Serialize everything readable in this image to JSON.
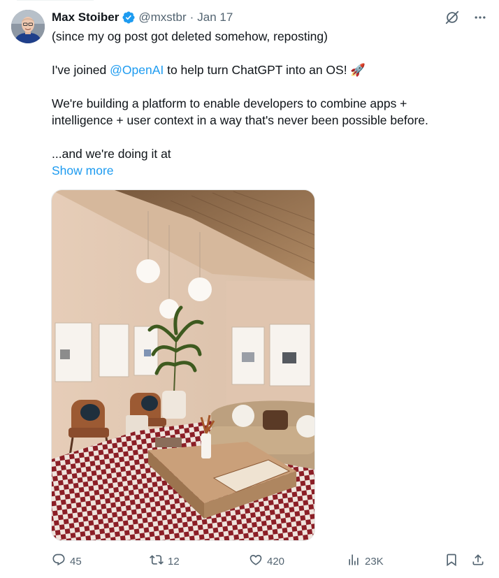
{
  "tweet": {
    "author_name": "Max Stoiber",
    "handle": "@mxstbr",
    "separator": "·",
    "date": "Jan 17",
    "paragraph1": "(since my og post got deleted somehow, reposting)",
    "paragraph2_before": "I've joined ",
    "paragraph2_mention": "@OpenAI",
    "paragraph2_after": " to help turn ChatGPT into an OS! 🚀",
    "paragraph3_line1": "We're building a platform to enable developers to combine apps +",
    "paragraph3_line2": "intelligence + user context in a way that's never been possible before.",
    "paragraph4": "...and we're doing it at",
    "show_more": "Show more"
  },
  "actions": {
    "replies": "45",
    "reposts": "12",
    "likes": "420",
    "views": "23K"
  },
  "icons": {
    "verified": "verified-badge-icon",
    "grok": "grok-icon",
    "more": "more-icon",
    "reply": "reply-icon",
    "repost": "repost-icon",
    "like": "like-icon",
    "views": "views-icon",
    "bookmark": "bookmark-icon",
    "share": "share-icon"
  },
  "colors": {
    "accent": "#1d9bf0",
    "secondary_text": "#536471",
    "primary_text": "#0f1419"
  }
}
